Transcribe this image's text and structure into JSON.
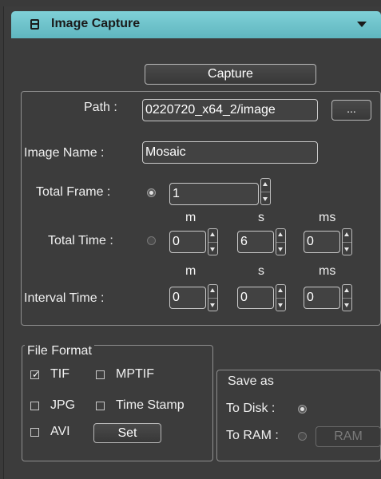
{
  "panel": {
    "title": "Image Capture"
  },
  "capture_button": "Capture",
  "path": {
    "label": "Path :",
    "value": "0220720_x64_2/image",
    "browse_label": "..."
  },
  "image_name": {
    "label": "Image Name :",
    "value": "Mosaic"
  },
  "total_frame": {
    "label": "Total Frame :",
    "value": "1",
    "selected": true
  },
  "total_time": {
    "label": "Total Time :",
    "units": [
      "m",
      "s",
      "ms"
    ],
    "values": [
      "0",
      "6",
      "0"
    ],
    "selected": false
  },
  "interval_time": {
    "label": "Interval Time :",
    "units": [
      "m",
      "s",
      "ms"
    ],
    "values": [
      "0",
      "0",
      "0"
    ]
  },
  "file_format": {
    "legend": "File Format",
    "options": [
      {
        "label": "TIF",
        "checked": true
      },
      {
        "label": "MPTIF",
        "checked": false
      },
      {
        "label": "JPG",
        "checked": false
      },
      {
        "label": "Time Stamp",
        "checked": false
      },
      {
        "label": "AVI",
        "checked": false
      }
    ],
    "set_label": "Set"
  },
  "save_as": {
    "legend": "Save as",
    "to_disk_label": "To Disk :",
    "to_ram_label": "To RAM :",
    "ram_button": "RAM",
    "to_disk_selected": true
  },
  "colors": {
    "header": "#6cc3cb",
    "background": "#3c3c3c"
  }
}
